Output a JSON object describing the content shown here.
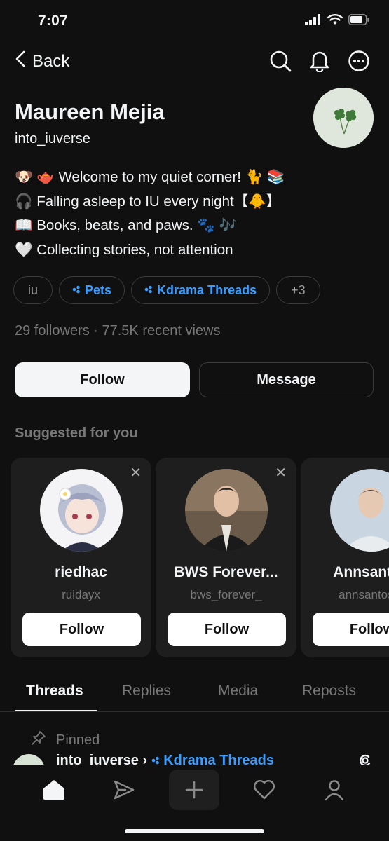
{
  "status_bar": {
    "time": "7:07"
  },
  "nav": {
    "back_label": "Back",
    "icons": [
      "search-icon",
      "bell-icon",
      "more-icon"
    ]
  },
  "profile": {
    "name": "Maureen Mejia",
    "handle": "into_iuverse",
    "bio_lines": [
      "🐶 🫖 Welcome to my quiet corner! 🐈 📚",
      "🎧 Falling asleep to IU every night【🐥】",
      "📖 Books, beats, and paws. 🐾 🎶",
      "🤍 Collecting stories, not attention"
    ],
    "tags": [
      {
        "label": "iu",
        "type": "plain"
      },
      {
        "label": "Pets",
        "type": "topic"
      },
      {
        "label": "Kdrama Threads",
        "type": "topic"
      },
      {
        "label": "+3",
        "type": "plain"
      }
    ],
    "stats": "29 followers · 77.5K recent views",
    "follow_label": "Follow",
    "message_label": "Message"
  },
  "suggested": {
    "title": "Suggested for you",
    "cards": [
      {
        "name": "riedhac",
        "handle": "ruidayx",
        "button": "Follow"
      },
      {
        "name": "BWS Forever...",
        "handle": "bws_forever_",
        "button": "Follow"
      },
      {
        "name": "Annsantos",
        "handle": "annsantostu",
        "button": "Follow"
      }
    ]
  },
  "tabs": [
    "Threads",
    "Replies",
    "Media",
    "Reposts"
  ],
  "pinned_label": "Pinned",
  "post_preview": {
    "author": "into_iuverse",
    "separator": "›",
    "topic": "Kdrama Threads"
  },
  "bottom_nav": [
    "home-icon",
    "send-icon",
    "plus-icon",
    "heart-icon",
    "profile-icon"
  ],
  "colors": {
    "background": "#101010",
    "accent": "#3b9eff",
    "muted": "#777777",
    "text": "#f3f5f7"
  }
}
